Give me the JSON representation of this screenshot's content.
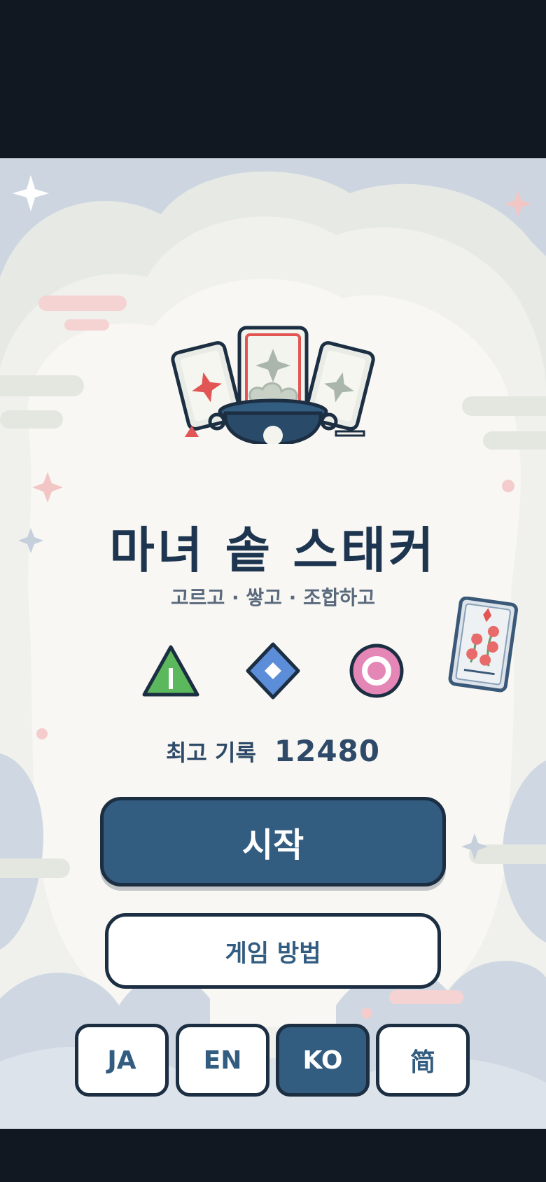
{
  "title": "마녀 솥 스태커",
  "subtitle": "고르고 · 쌓고 · 조합하고",
  "symbols": [
    "triangle-symbol",
    "diamond-symbol",
    "circle-symbol"
  ],
  "best_score": {
    "label": "최고 기록",
    "value": "12480"
  },
  "buttons": {
    "start": "시작",
    "how_to_play": "게임 방법"
  },
  "languages": [
    {
      "label": "JA",
      "active": false
    },
    {
      "label": "EN",
      "active": false
    },
    {
      "label": "KO",
      "active": true
    },
    {
      "label": "简",
      "active": false
    }
  ],
  "colors": {
    "navy": "#335c81",
    "outline": "#1c2e42",
    "title": "#1e3550",
    "triangle": "#5cb85c",
    "diamond": "#5b8dd9",
    "circle": "#e486b6",
    "accent_red": "#e25555"
  }
}
